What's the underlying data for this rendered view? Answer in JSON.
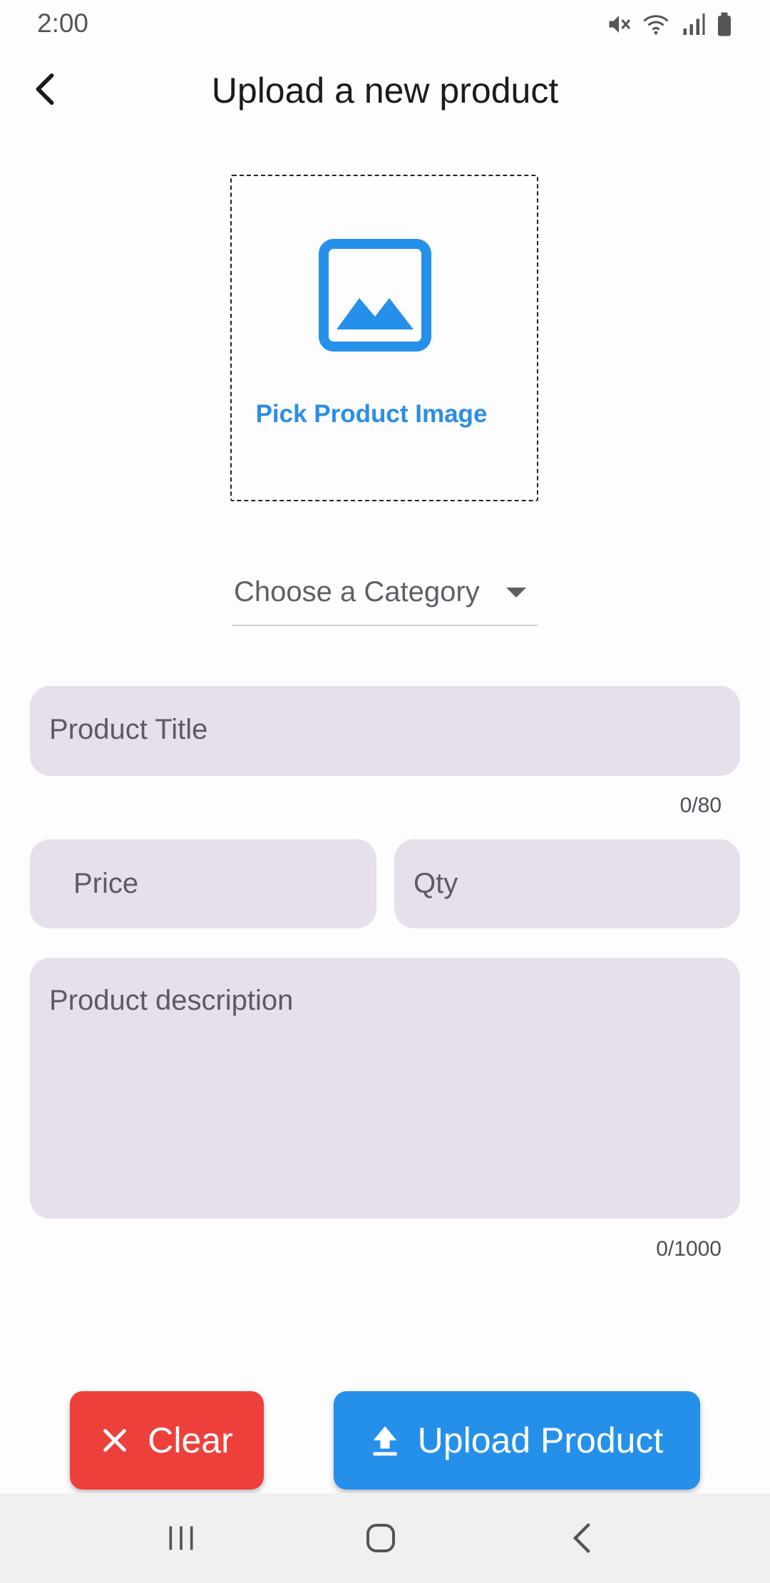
{
  "status_bar": {
    "time": "2:00",
    "icons": [
      "mute-icon",
      "wifi-icon",
      "signal-icon",
      "battery-icon"
    ]
  },
  "app_bar": {
    "title": "Upload a new product",
    "back_icon": "chevron-left-icon"
  },
  "image_picker": {
    "icon": "image-icon",
    "label": "Pick Product Image"
  },
  "category": {
    "label": "Choose a Category"
  },
  "form": {
    "title_label": "Product Title",
    "title_counter": "0/80",
    "price_label": "Price",
    "qty_label": "Qty",
    "description_label": "Product description",
    "description_counter": "0/1000"
  },
  "actions": {
    "clear_label": "Clear",
    "upload_label": "Upload Product"
  },
  "colors": {
    "accent": "#2590ea",
    "danger": "#ee403a",
    "field_bg": "#e7dfec"
  }
}
